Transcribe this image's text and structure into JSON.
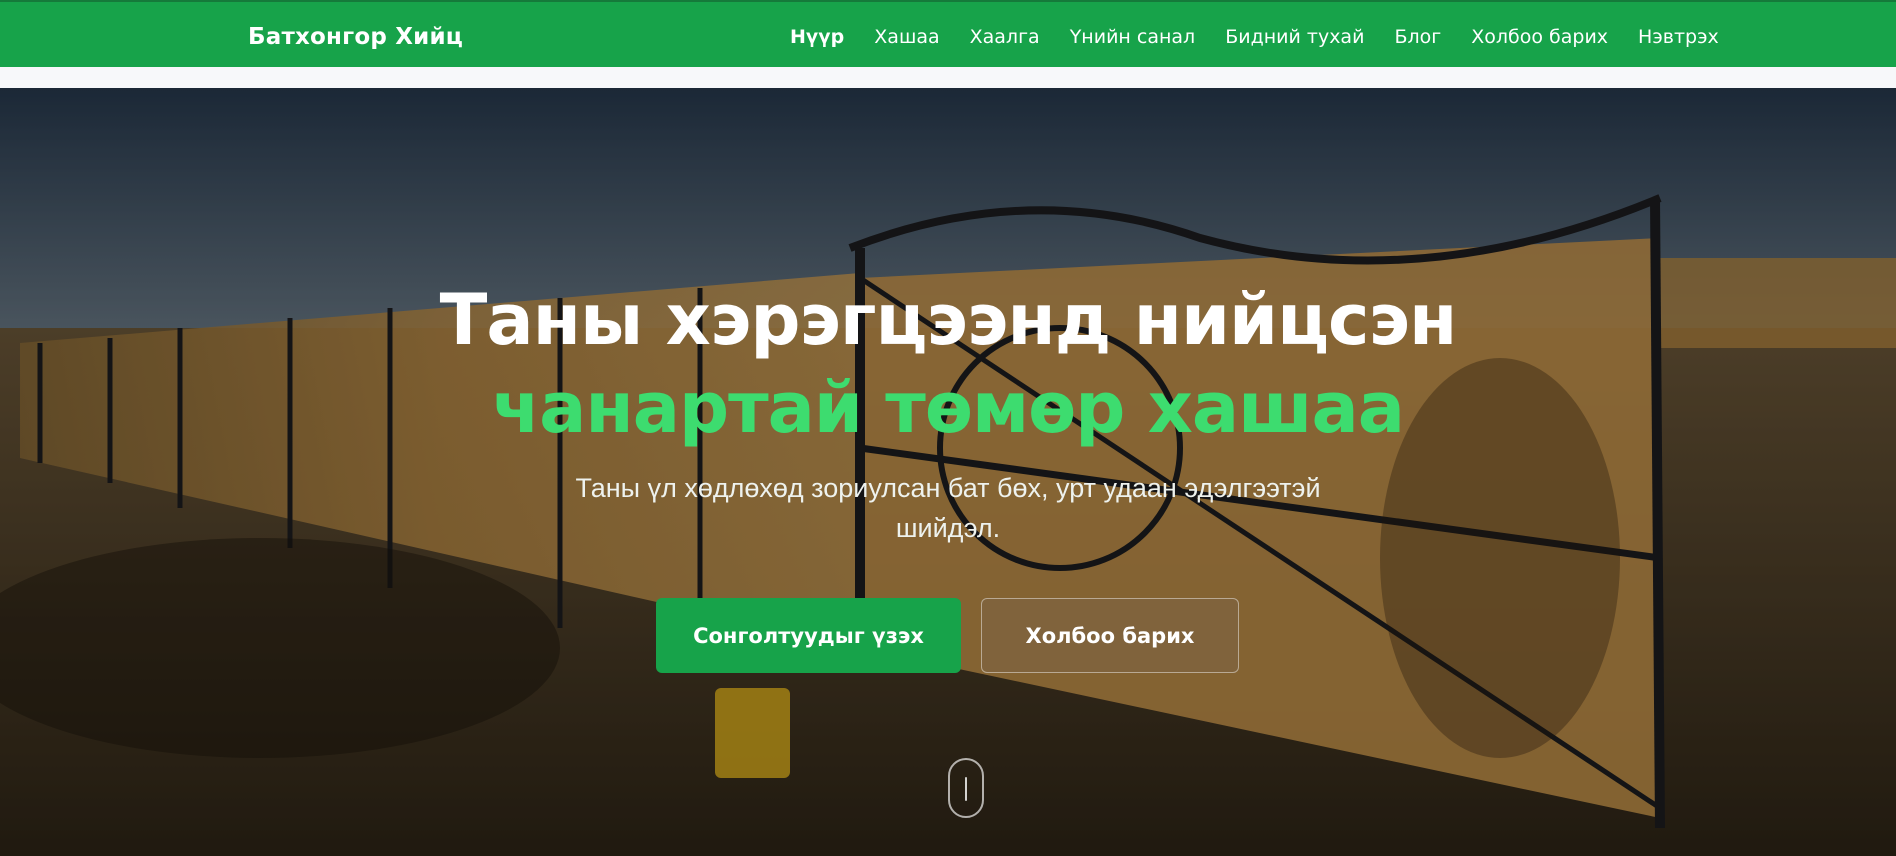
{
  "navbar": {
    "brand": "Батхонгор Хийц",
    "links": [
      {
        "label": "Нүүр",
        "active": true
      },
      {
        "label": "Хашаа",
        "active": false
      },
      {
        "label": "Хаалга",
        "active": false
      },
      {
        "label": "Үнийн санал",
        "active": false
      },
      {
        "label": "Бидний тухай",
        "active": false
      },
      {
        "label": "Блог",
        "active": false
      },
      {
        "label": "Холбоо барих",
        "active": false
      },
      {
        "label": "Нэвтрэх",
        "active": false
      }
    ]
  },
  "hero": {
    "title_line1": "Таны хэрэгцээнд нийцсэн",
    "title_line2": "чанартай төмөр хашаа",
    "subtitle": "Таны үл хөдлөхөд зориулсан бат бөх, урт удаан эдэлгээтэй шийдэл.",
    "primary_button": "Сонголтуудыг үзэх",
    "secondary_button": "Холбоо барих"
  },
  "colors": {
    "brand_green": "#17a34a",
    "accent_green": "#3ddc6f"
  },
  "icons": {
    "scroll": "mouse-scroll-icon"
  }
}
